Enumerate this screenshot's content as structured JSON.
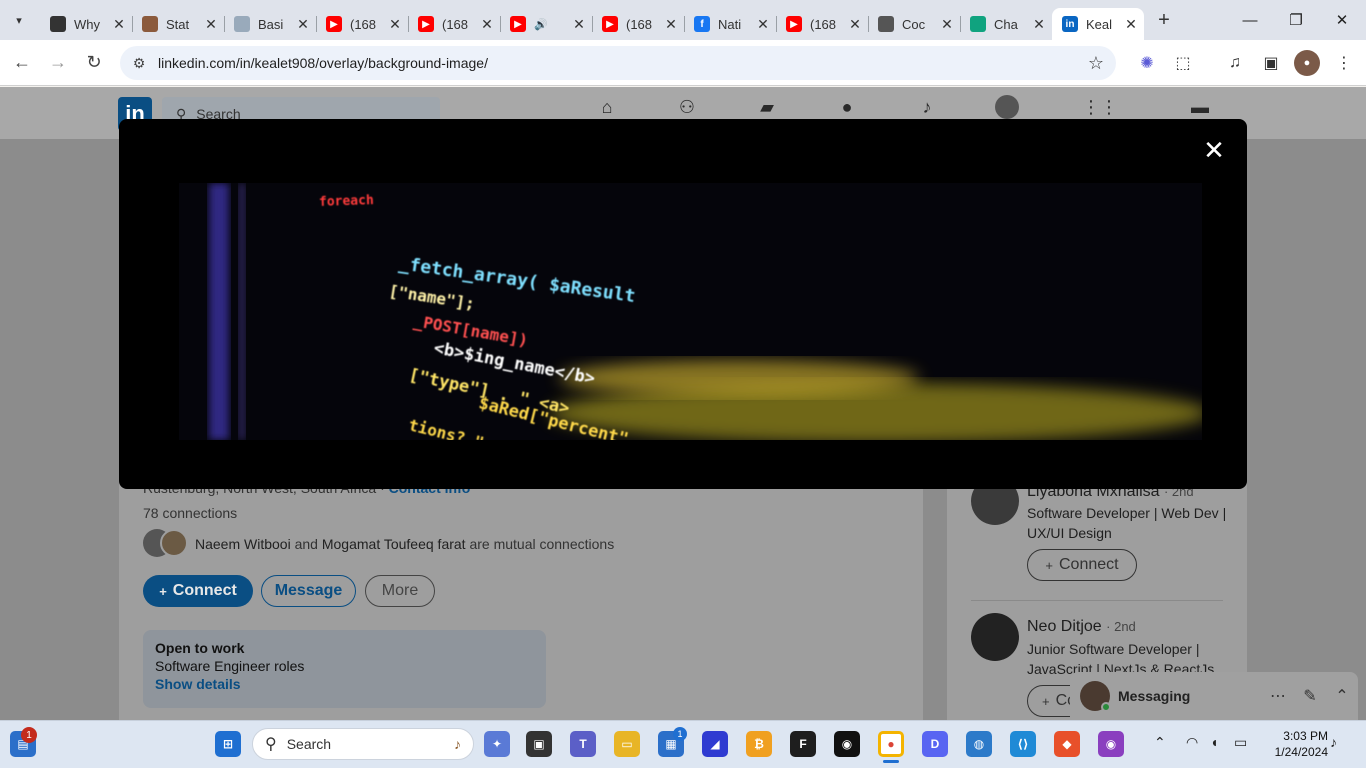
{
  "browser": {
    "tabs": [
      {
        "title": "Why",
        "favicon": "doc-icon",
        "color": "#333333",
        "active": false
      },
      {
        "title": "Stat",
        "favicon": "avatar-icon",
        "color": "#8b5a3c",
        "active": false
      },
      {
        "title": "Basi",
        "favicon": "doc-icon",
        "color": "#9ab",
        "active": false
      },
      {
        "title": "(168",
        "favicon": "youtube-icon",
        "color": "#ff0000",
        "active": false
      },
      {
        "title": "(168",
        "favicon": "youtube-icon",
        "color": "#ff0000",
        "active": false
      },
      {
        "title": "",
        "favicon": "youtube-icon",
        "color": "#ff0000",
        "active": false,
        "audio": true
      },
      {
        "title": "(168",
        "favicon": "youtube-icon",
        "color": "#ff0000",
        "active": false
      },
      {
        "title": "Nati",
        "favicon": "facebook-icon",
        "color": "#1877f2",
        "active": false
      },
      {
        "title": "(168",
        "favicon": "youtube-icon",
        "color": "#ff0000",
        "active": false
      },
      {
        "title": "Coc",
        "favicon": "globe-icon",
        "color": "#555555",
        "active": false
      },
      {
        "title": "Cha",
        "favicon": "chatgpt-icon",
        "color": "#10a37f",
        "active": false
      },
      {
        "title": "Keal",
        "favicon": "linkedin-icon",
        "color": "#0a66c2",
        "active": true
      }
    ],
    "url": "linkedin.com/in/kealet908/overlay/background-image/"
  },
  "linkedin": {
    "search_placeholder": "Search",
    "location": "Rustenburg, North West, South Africa",
    "contact_info": "Contact info",
    "connections": "78 connections",
    "mutual": {
      "name1": "Naeem Witbooi",
      "and": "and",
      "name2": "Mogamat Toufeeq farat",
      "suffix": "are mutual connections"
    },
    "buttons": {
      "connect": "Connect",
      "message": "Message",
      "more": "More"
    },
    "open_to_work": {
      "title": "Open to work",
      "roles": "Software Engineer roles",
      "link": "Show details"
    },
    "suggestions": [
      {
        "name": "Liyabona Mxhalisa",
        "degree": "· 2nd",
        "headline": "Software Developer | Web Dev | UX/UI Design",
        "button": "Connect"
      },
      {
        "name": "Neo Ditjoe",
        "degree": "· 2nd",
        "headline": "Junior Software Developer | JavaScript | NextJs & ReactJs",
        "button": "Co"
      }
    ],
    "messaging": "Messaging"
  },
  "modal": {
    "close_icon": "close-icon",
    "code_lines": [
      {
        "text": "foreach",
        "color": "#ff3b3b"
      },
      {
        "text": "_fetch_array( $aResult",
        "color": "#7fe0ff"
      },
      {
        "text": "[\"name\"];",
        "color": "#fff2a8"
      },
      {
        "text": "_POST[name])",
        "color": "#ff5050"
      },
      {
        "text": "<b>$ing_name</b>",
        "color": "#ffffff"
      },
      {
        "text": "[\"type\"] . \" <a>",
        "color": "#ffe566"
      },
      {
        "text": "$aRed[\"percent\"",
        "color": "#ffd94a"
      },
      {
        "text": "tions? \" . $aRed",
        "color": "#ffd94a"
      }
    ]
  },
  "taskbar": {
    "search": "Search",
    "time": "3:03 PM",
    "date": "1/24/2024",
    "widget_badge": "1",
    "store_badge": "1"
  }
}
